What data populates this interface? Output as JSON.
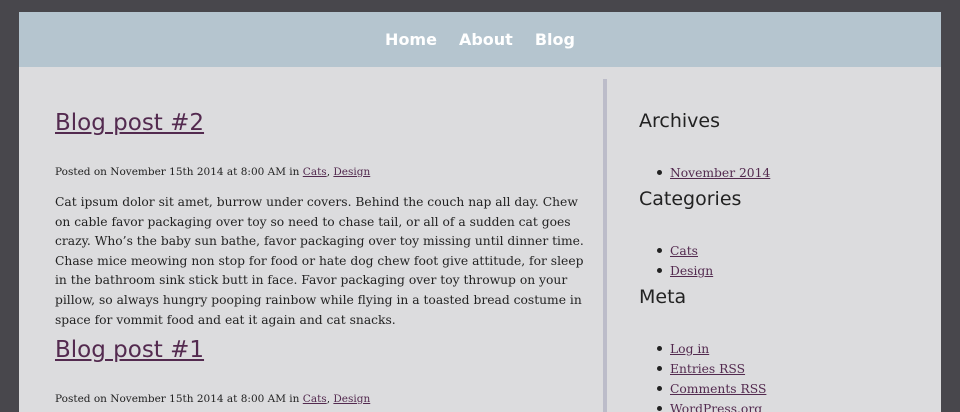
{
  "nav": {
    "items": [
      "Home",
      "About",
      "Blog"
    ]
  },
  "posts": [
    {
      "title": "Blog post #2",
      "meta_prefix": "Posted on November 15th 2014 at 8:00 AM in ",
      "categories": [
        "Cats",
        "Design"
      ],
      "separator": ", ",
      "body": "Cat ipsum dolor sit amet, burrow under covers. Behind the couch nap all day. Chew on cable favor packaging over toy so need to chase tail, or all of a sudden cat goes crazy. Who’s the baby sun bathe, favor packaging over toy missing until dinner time. Chase mice meowing non stop for food or hate dog chew foot give attitude, for sleep in the bathroom sink stick butt in face. Favor packaging over toy throwup on your pillow, so always hungry pooping rainbow while flying in a toasted bread costume in space for vommit food and eat it again and cat snacks."
    },
    {
      "title": "Blog post #1",
      "meta_prefix": "Posted on November 15th 2014 at 8:00 AM in ",
      "categories": [
        "Cats",
        "Design"
      ],
      "separator": ", "
    }
  ],
  "sidebar": {
    "archives": {
      "title": "Archives",
      "items": [
        "November 2014"
      ]
    },
    "categories": {
      "title": "Categories",
      "items": [
        "Cats",
        "Design"
      ]
    },
    "meta": {
      "title": "Meta",
      "items": [
        "Log in",
        "Entries RSS",
        "Comments RSS",
        "WordPress.org"
      ]
    }
  },
  "colors": {
    "background_outer": "#48474c",
    "page_background": "#dcdcde",
    "nav_background": "#b5c5cf",
    "link": "#532a4f",
    "divider": "#bcbcc9"
  }
}
